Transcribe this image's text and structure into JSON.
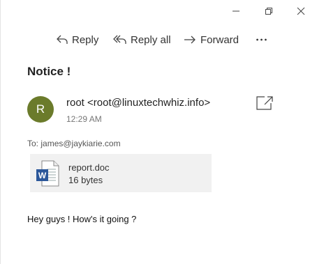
{
  "window": {
    "minimize_icon": "minimize-icon",
    "restore_icon": "restore-icon",
    "close_icon": "close-icon"
  },
  "toolbar": {
    "reply_label": "Reply",
    "reply_all_label": "Reply all",
    "forward_label": "Forward",
    "more_label": "•••"
  },
  "message": {
    "subject": "Notice !",
    "avatar_initial": "R",
    "avatar_color": "#6b7b2b",
    "sender": "root <root@linuxtechwhiz.info>",
    "time": "12:29 AM",
    "to_label": "To:",
    "to_address": "james@jaykiarie.com",
    "body": "Hey guys ! How's it going ?"
  },
  "attachment": {
    "name": "report.doc",
    "size": "16 bytes",
    "icon": "word-document-icon",
    "icon_color": "#2b579a"
  }
}
